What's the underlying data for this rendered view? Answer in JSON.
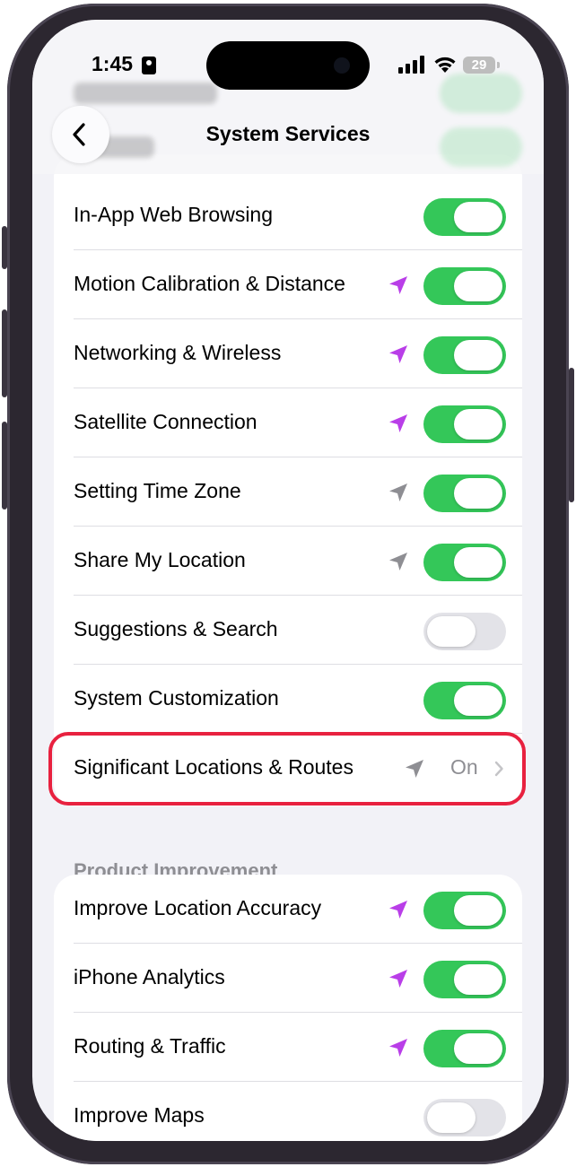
{
  "status_bar": {
    "time": "1:45",
    "battery": "29"
  },
  "nav": {
    "title": "System Services",
    "back_icon": "chevron-left-icon"
  },
  "colors": {
    "toggle_on": "#34c759",
    "toggle_off": "#e3e3e8",
    "location_active": "#b93ee8",
    "location_recent": "#8e8e93",
    "highlight": "#e8213f"
  },
  "services": [
    {
      "label": "In-App Web Browsing",
      "location_icon": "none",
      "toggle": "on"
    },
    {
      "label": "Motion Calibration & Distance",
      "location_icon": "purple-arrow-icon",
      "toggle": "on"
    },
    {
      "label": "Networking & Wireless",
      "location_icon": "purple-arrow-icon",
      "toggle": "on"
    },
    {
      "label": "Satellite Connection",
      "location_icon": "purple-arrow-icon",
      "toggle": "on"
    },
    {
      "label": "Setting Time Zone",
      "location_icon": "gray-arrow-icon",
      "toggle": "on"
    },
    {
      "label": "Share My Location",
      "location_icon": "gray-arrow-icon",
      "toggle": "on"
    },
    {
      "label": "Suggestions & Search",
      "location_icon": "none",
      "toggle": "off"
    },
    {
      "label": "System Customization",
      "location_icon": "none",
      "toggle": "on"
    },
    {
      "label": "Significant Locations & Routes",
      "location_icon": "gray-arrow-icon",
      "value": "On"
    }
  ],
  "product_improvement": {
    "header": "Product Improvement",
    "items": [
      {
        "label": "Improve Location Accuracy",
        "location_icon": "purple-arrow-icon",
        "toggle": "on"
      },
      {
        "label": "iPhone Analytics",
        "location_icon": "purple-arrow-icon",
        "toggle": "on"
      },
      {
        "label": "Routing & Traffic",
        "location_icon": "purple-arrow-icon",
        "toggle": "on"
      },
      {
        "label": "Improve Maps",
        "location_icon": "none",
        "toggle": "off"
      }
    ]
  }
}
